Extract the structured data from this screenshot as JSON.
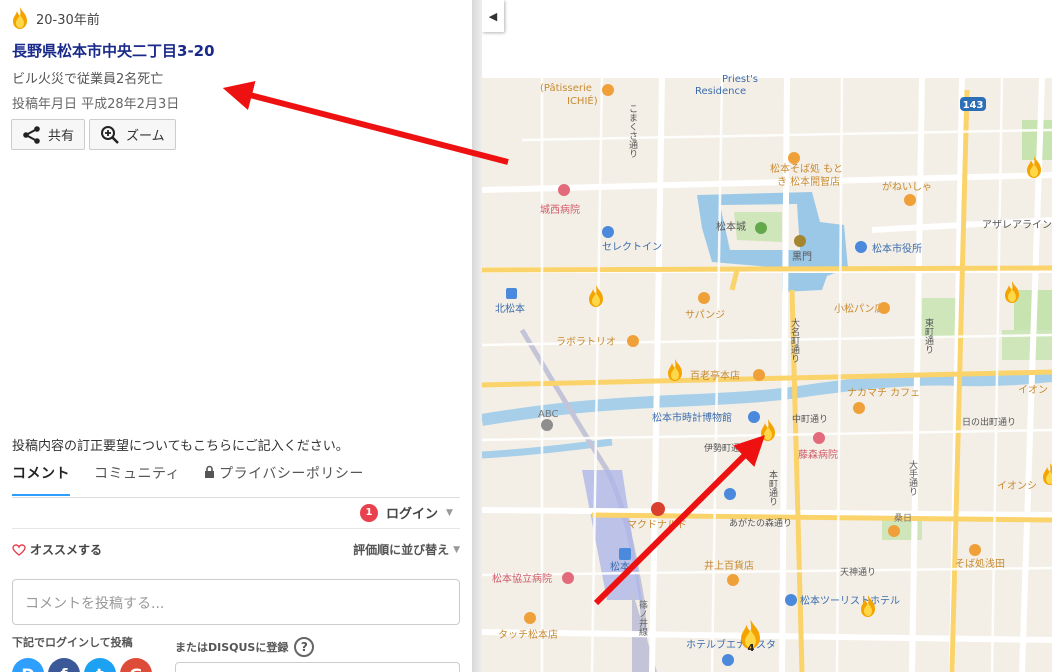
{
  "post": {
    "age_label": "20-30年前",
    "address": "長野県松本市中央二丁目3-20",
    "description": "ビル火災で従業員2名死亡",
    "posted_date": "投稿年月日 平成28年2月3日",
    "share_label": "共有",
    "zoom_label": "ズーム"
  },
  "notice": "投稿内容の訂正要望についてもこちらにご記入ください。",
  "disqus": {
    "tabs": [
      "コメント",
      "コミュニティ",
      "プライバシーポリシー"
    ],
    "notification_count": "1",
    "login_label": "ログイン",
    "recommend_label": "オススメする",
    "sort_label": "評価順に並び替え",
    "comment_placeholder": "コメントを投稿する...",
    "login_with_label": "下記でログインして投稿",
    "register_label": "またはDISQUSに登録",
    "help_label": "?",
    "social_buttons": [
      "D",
      "f",
      "t",
      "G"
    ]
  },
  "map": {
    "labels": {
      "patisserie": "(Pâtisserie",
      "ichie": "ICHIÉ)",
      "residence": "Residence",
      "priest": "Priest's",
      "machi": "こまくさ通り",
      "route143": "143",
      "soba1": "松本そば処 もと",
      "soba2": "き 松本開智店",
      "ganeisha": "がねいしゃ",
      "hospital_josai": "城西病院",
      "castle": "松本城",
      "azalea": "アザレアライン",
      "kuromon": "黒門",
      "cityhall": "松本市役所",
      "select_inn": "セレクトイン",
      "kitamatsumoto": "北松本",
      "sapanji": "サパンジ",
      "komatsu": "小松パン店",
      "laboratorio": "ラボラトリオ",
      "omachi": "大名町通り",
      "higashimachi": "東町通り",
      "hyakuroutei": "百老亭本店",
      "nakamachi": "ナカマチ カフェ",
      "abc": "ABC",
      "ion": "イオン",
      "museum": "松本市時計博物館",
      "nakamachi_dori": "中町通り",
      "hinode": "日の出町通り",
      "isemachi": "伊勢町通",
      "fujimori": "藤森病院",
      "honmachi": "本町通り",
      "omote": "大手通り",
      "ion2": "イオンシ",
      "mcdonalds": "マクドナルド",
      "agatanomori": "あがたの森通り",
      "kiriba": "桑日",
      "inoue": "井上百貨店",
      "soba_asada": "そば処浅田",
      "tenjin": "天神通り",
      "kyoritsu": "松本協立病院",
      "tourist_hotel": "松本ツーリストホテル",
      "touch": "タッチ松本店",
      "hotel_buena": "ホテルブエナビスタ",
      "cluster_count": "4",
      "station": "松本",
      "shinonoi": "篠ノ井線"
    }
  },
  "colors": {
    "title_blue": "#1a2a8a",
    "badge_red": "#e9404d",
    "arrow_red": "#ee1111",
    "accent_blue": "#2e9fff"
  }
}
